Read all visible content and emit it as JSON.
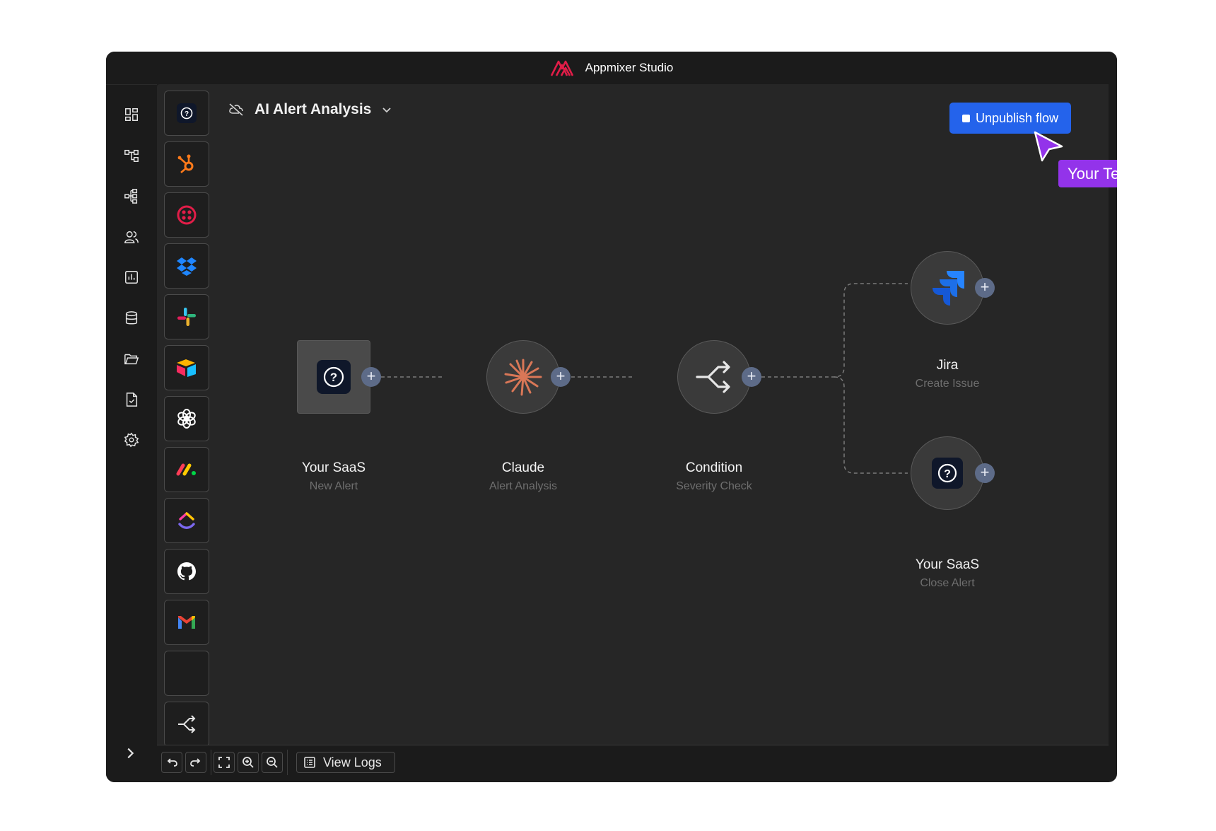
{
  "app": {
    "title": "Appmixer Studio"
  },
  "flow": {
    "name": "AI Alert Analysis"
  },
  "actions": {
    "unpublish_label": "Unpublish flow"
  },
  "collaborator": {
    "label": "Your Team",
    "color": "#9333ea"
  },
  "colors": {
    "accent": "#2463eb",
    "plus_button": "#5d6b88",
    "canvas": "#262626"
  },
  "nav": {
    "items": [
      "dashboard-icon",
      "flows-icon",
      "integrations-icon",
      "users-icon",
      "insights-icon",
      "data-stores-icon",
      "files-icon",
      "compliance-icon",
      "settings-icon"
    ],
    "expand_icon": "chevron-right-icon"
  },
  "palette": {
    "items": [
      "your-saas",
      "hubspot",
      "twilio",
      "dropbox",
      "slack",
      "airtable",
      "openai",
      "monday",
      "clickup",
      "github",
      "gmail",
      "empty",
      "condition"
    ]
  },
  "nodes": [
    {
      "id": "trigger",
      "title": "Your SaaS",
      "subtitle": "New Alert",
      "icon": "question-app-icon"
    },
    {
      "id": "claude",
      "title": "Claude",
      "subtitle": "Alert Analysis",
      "icon": "claude-icon"
    },
    {
      "id": "condition",
      "title": "Condition",
      "subtitle": "Severity Check",
      "icon": "branch-icon"
    },
    {
      "id": "jira",
      "title": "Jira",
      "subtitle": "Create Issue",
      "icon": "jira-icon"
    },
    {
      "id": "close",
      "title": "Your SaaS",
      "subtitle": "Close Alert",
      "icon": "question-app-icon"
    }
  ],
  "toolbar": {
    "view_logs_label": "View Logs"
  }
}
